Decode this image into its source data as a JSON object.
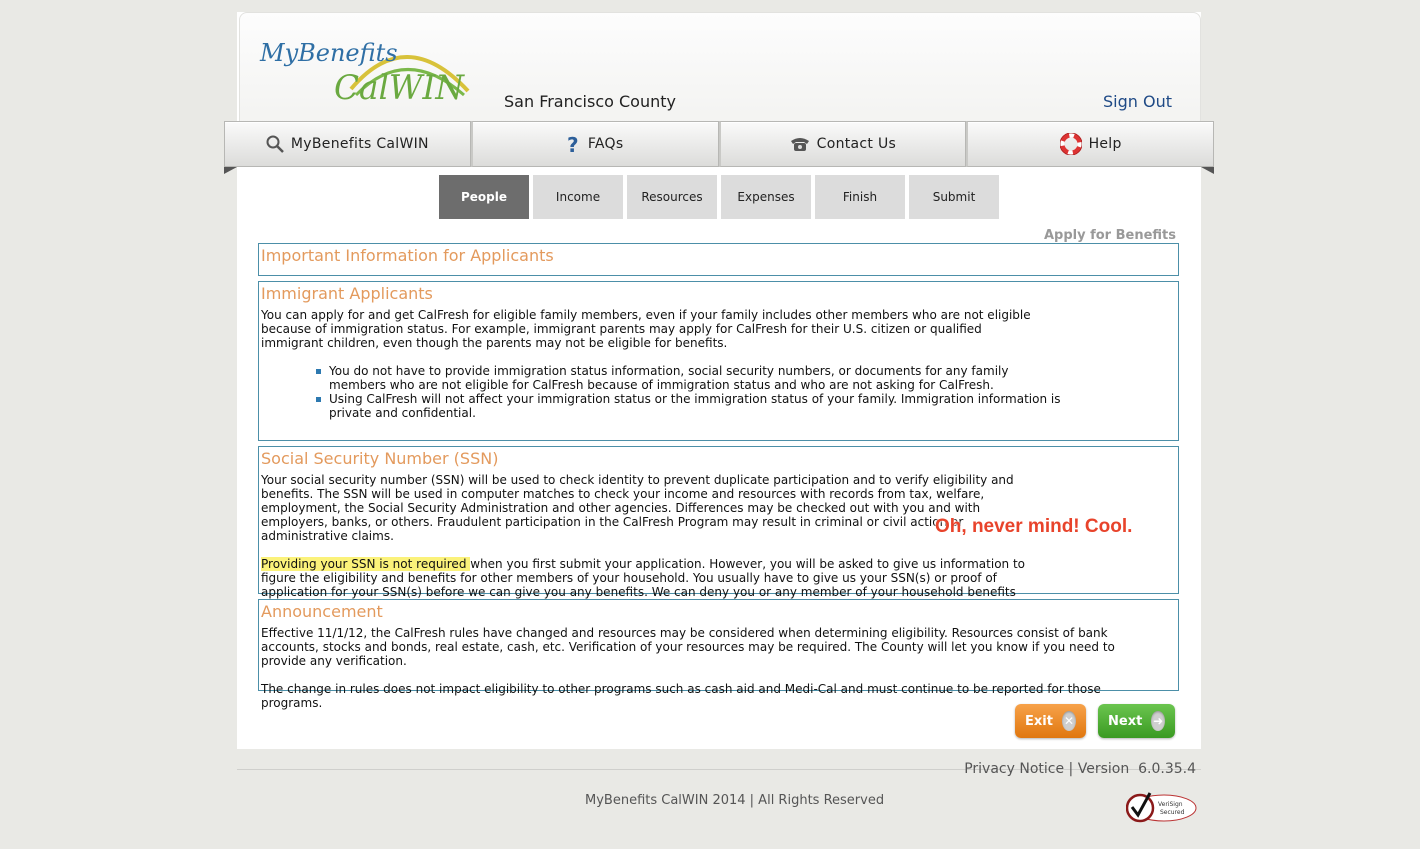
{
  "header": {
    "logo_text_1": "MyBenefits",
    "logo_text_2": "CalWIN",
    "county": "San Francisco County",
    "sign_out": "Sign Out"
  },
  "nav": {
    "tabs": [
      {
        "label": "MyBenefits CalWIN",
        "icon": "search-icon"
      },
      {
        "label": "FAQs",
        "icon": "question-icon"
      },
      {
        "label": "Contact Us",
        "icon": "phone-icon"
      },
      {
        "label": "Help",
        "icon": "lifebuoy-icon"
      }
    ]
  },
  "steps": [
    "People",
    "Income",
    "Resources",
    "Expenses",
    "Finish",
    "Submit"
  ],
  "active_step": "People",
  "apply_label": "Apply for Benefits",
  "sections": {
    "important": {
      "title": "Important Information for Applicants"
    },
    "immigrant": {
      "title": "Immigrant Applicants",
      "para": "You can apply for and get CalFresh for eligible family members, even if your family includes other members who are not eligible because of immigration status. For example, immigrant parents may apply for CalFresh for their U.S. citizen or qualified immigrant children, even though the parents may not be eligible for benefits.",
      "bullets": [
        "You do not have to provide immigration status information, social security numbers, or documents for any family members who are not eligible for CalFresh because of immigration status and who are not asking for CalFresh.",
        "Using CalFresh will not affect your immigration status or the immigration status of your family. Immigration information is private and confidential."
      ]
    },
    "ssn": {
      "title": "Social Security Number (SSN)",
      "para1": "Your social security number (SSN) will be used to check identity to prevent duplicate participation and to verify eligibility and benefits. The SSN will be used in computer matches to check your income and resources with records from tax, welfare, employment, the Social Security Administration and other agencies. Differences may be checked out with you and with employers, banks, or others. Fraudulent participation in the CalFresh Program may result in criminal or civil action or administrative claims.",
      "para2_highlight": "Providing your SSN is not required ",
      "para2_rest": "when you first submit your application. However, you will be asked to give us information to figure the eligibility and benefits for other members of your household. You usually have to give us your SSN(s) or proof of application for your SSN(s) before we can give you any benefits. We can deny you or any member of your household benefits for failure to provide an SSN."
    },
    "announcement": {
      "title": "Announcement",
      "para1": "Effective 11/1/12, the CalFresh rules have changed and resources may be considered when determining eligibility. Resources consist of bank accounts, stocks and bonds, real estate, cash, etc. Verification of your resources may be required. The County will let you know if you need to provide any verification.",
      "para2": "The change in rules does not impact eligibility to other programs such as cash aid and Medi-Cal and must continue to be reported for those programs."
    }
  },
  "annotation": "Oh, never mind! Cool.",
  "buttons": {
    "exit": "Exit",
    "next": "Next"
  },
  "footer": {
    "privacy": "Privacy Notice",
    "sep": " | ",
    "version_label": "Version",
    "version_num": "6.0.35.4",
    "copyright": "MyBenefits CalWIN 2014 | All Rights Reserved",
    "badge_line1": "VeriSign",
    "badge_line2": "Secured"
  },
  "colors": {
    "section_title": "#e39a5d",
    "box_border": "#4c8fa8",
    "active_step": "#6d6d6d",
    "exit_button": "#e0770f",
    "next_button": "#3a9a22",
    "annotation": "#e8432b",
    "link": "#1f4a86"
  }
}
